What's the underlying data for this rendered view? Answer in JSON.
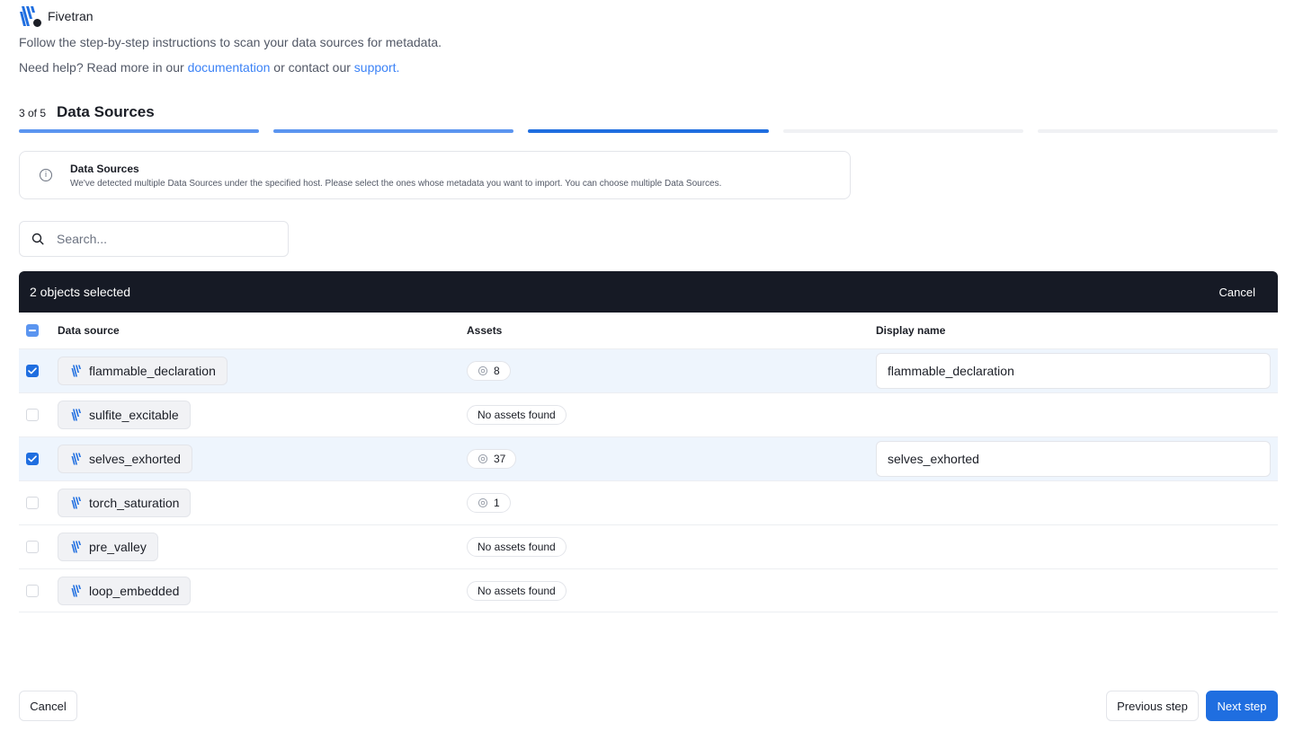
{
  "app": {
    "brand": "Fivetran",
    "intro": "Follow the step-by-step instructions to scan your data sources for metadata.",
    "help_prefix": "Need help? Read more in our ",
    "help_link_docs": "documentation",
    "help_middle": " or contact our ",
    "help_link_support": "support."
  },
  "step": {
    "count": "3 of 5",
    "title": "Data Sources",
    "total": 5,
    "current": 3
  },
  "info": {
    "title": "Data Sources",
    "text": "We've detected multiple Data Sources under the specified host. Please select the ones whose metadata you want to import. You can choose multiple Data Sources."
  },
  "search": {
    "placeholder": "Search...",
    "value": ""
  },
  "selection": {
    "count_label": "2 objects selected",
    "cancel_label": "Cancel"
  },
  "table": {
    "headers": {
      "source": "Data source",
      "assets": "Assets",
      "display": "Display name"
    },
    "rows": [
      {
        "name": "flammable_declaration",
        "selected": true,
        "assets": "8",
        "display": "flammable_declaration"
      },
      {
        "name": "sulfite_excitable",
        "selected": false,
        "assets": "No assets found",
        "display": ""
      },
      {
        "name": "selves_exhorted",
        "selected": true,
        "assets": "37",
        "display": "selves_exhorted"
      },
      {
        "name": "torch_saturation",
        "selected": false,
        "assets": "1",
        "display": ""
      },
      {
        "name": "pre_valley",
        "selected": false,
        "assets": "No assets found",
        "display": ""
      },
      {
        "name": "loop_embedded",
        "selected": false,
        "assets": "No assets found",
        "display": ""
      }
    ]
  },
  "footer": {
    "cancel": "Cancel",
    "previous": "Previous step",
    "next": "Next step"
  },
  "colors": {
    "primary": "#1f6ee0",
    "progress_done": "#5b95f0",
    "selection_bar": "#161a25",
    "link": "#3b82f6",
    "selected_row": "#eef5fd"
  },
  "icons": {
    "logo": "fivetran-logo-icon",
    "info": "info-icon",
    "search": "search-icon",
    "source": "fivetran-source-icon",
    "asset": "asset-cube-icon",
    "check": "check-icon"
  }
}
